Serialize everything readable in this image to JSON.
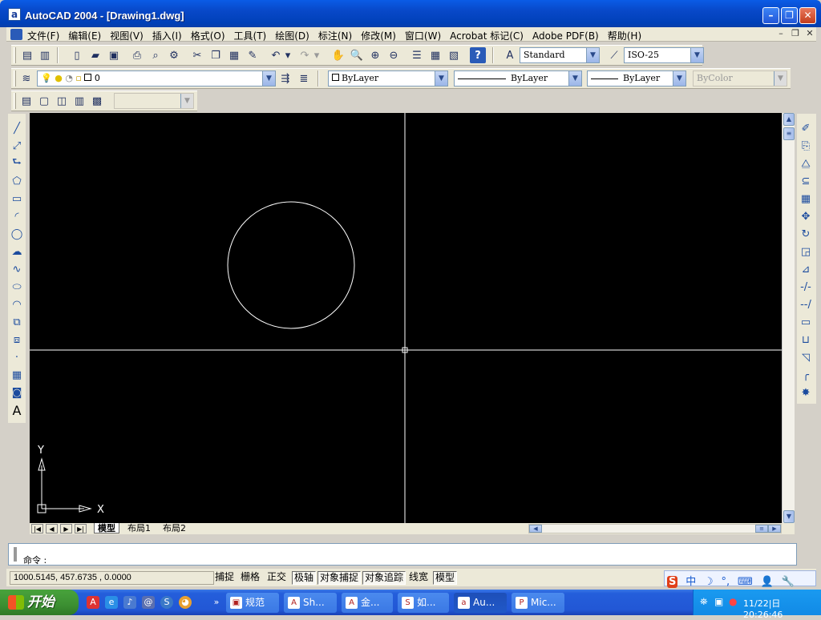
{
  "window": {
    "title": "AutoCAD 2004 - [Drawing1.dwg]",
    "app_icon": "a"
  },
  "menu": [
    "文件(F)",
    "编辑(E)",
    "视图(V)",
    "插入(I)",
    "格式(O)",
    "工具(T)",
    "绘图(D)",
    "标注(N)",
    "修改(M)",
    "窗口(W)",
    "Acrobat 标记(C)",
    "Adobe PDF(B)",
    "帮助(H)"
  ],
  "styles": {
    "text_style": "Standard",
    "dim_style": "ISO-25"
  },
  "layer": {
    "current": "0"
  },
  "properties": {
    "color": "ByLayer",
    "linetype": "ByLayer",
    "lineweight": "ByLayer",
    "plotstyle": "ByColor"
  },
  "ucs": {
    "x_label": "X",
    "y_label": "Y"
  },
  "layout_tabs": [
    "模型",
    "布局1",
    "布局2"
  ],
  "command": {
    "prompt": "命令 :"
  },
  "status": {
    "coordinates": "1000.5145, 457.6735 , 0.0000",
    "toggles": [
      {
        "label": "捕捉",
        "on": false
      },
      {
        "label": "栅格",
        "on": false
      },
      {
        "label": "正交",
        "on": false
      },
      {
        "label": "极轴",
        "on": true
      },
      {
        "label": "对象捕捉",
        "on": true
      },
      {
        "label": "对象追踪",
        "on": true
      },
      {
        "label": "线宽",
        "on": false
      },
      {
        "label": "模型",
        "on": true
      }
    ]
  },
  "ime": {
    "mode": "中"
  },
  "taskbar": {
    "start_label": "开始",
    "tasks": [
      "规范",
      "Sh...",
      "金...",
      "如...",
      "Au...",
      "Mic..."
    ],
    "clock": "11/22|日 20:26:46"
  },
  "colors": {
    "canvas": "#000000",
    "entity": "#ffffff",
    "title_blue": "#0848c8",
    "taskbar_blue": "#245edb",
    "start_green": "#3c8f32"
  }
}
